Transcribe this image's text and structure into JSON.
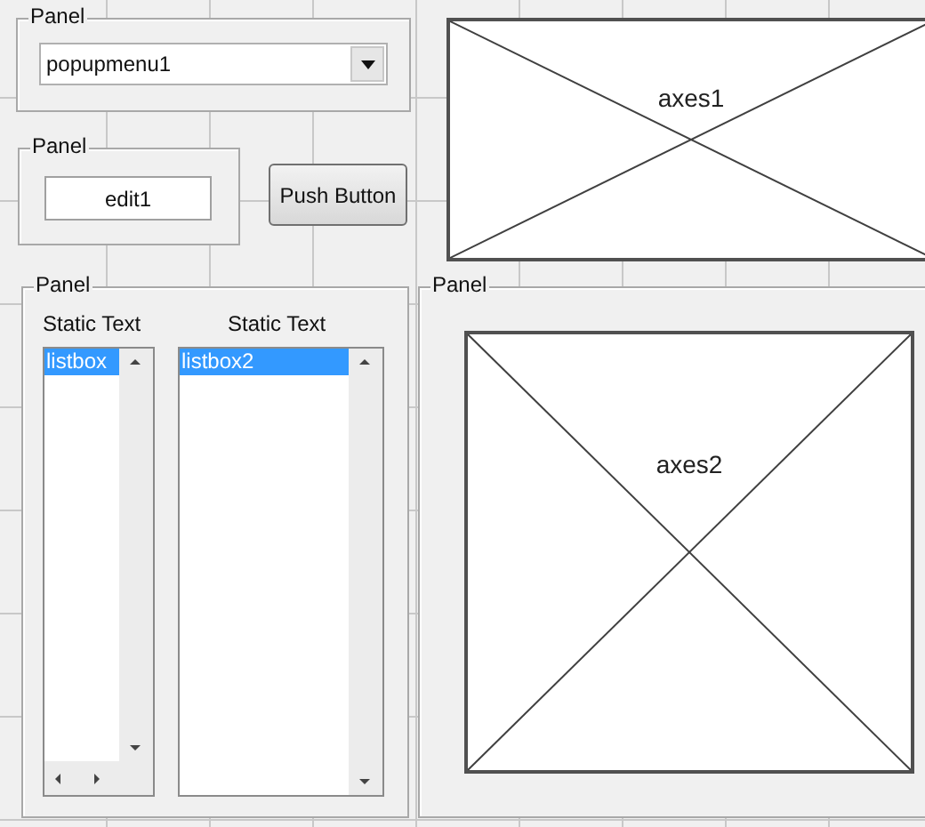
{
  "panels": [
    {
      "kind": "popup",
      "title": "Panel",
      "value": "popupmenu1"
    },
    {
      "kind": "edit",
      "title": "Panel",
      "value": "edit1"
    },
    {
      "kind": "lists",
      "title": "Panel",
      "lists": [
        {
          "heading": "Static Text",
          "items": [
            {
              "label": "listbox",
              "selected": true
            }
          ],
          "hscroll": true
        },
        {
          "heading": "Static Text",
          "items": [
            {
              "label": "listbox2",
              "selected": true
            }
          ],
          "hscroll": false
        }
      ]
    },
    {
      "kind": "axes",
      "title": "Panel",
      "axes": "axes2"
    }
  ],
  "push_button": "Push Button",
  "axes": "axes1"
}
